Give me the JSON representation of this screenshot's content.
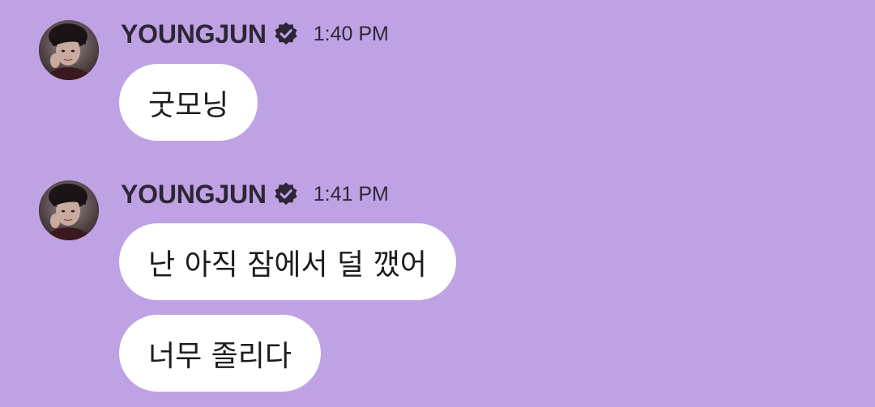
{
  "chat": {
    "groups": [
      {
        "sender": "YOUNGJUN",
        "verified_icon": "verified-badge-icon",
        "time": "1:40 PM",
        "messages": [
          "굿모닝"
        ]
      },
      {
        "sender": "YOUNGJUN",
        "verified_icon": "verified-badge-icon",
        "time": "1:41 PM",
        "messages": [
          "난 아직 잠에서 덜 깼어",
          "너무 졸리다"
        ]
      }
    ]
  },
  "colors": {
    "background": "#bea2e4",
    "bubble": "#ffffff",
    "text_dark": "#2e2536"
  }
}
